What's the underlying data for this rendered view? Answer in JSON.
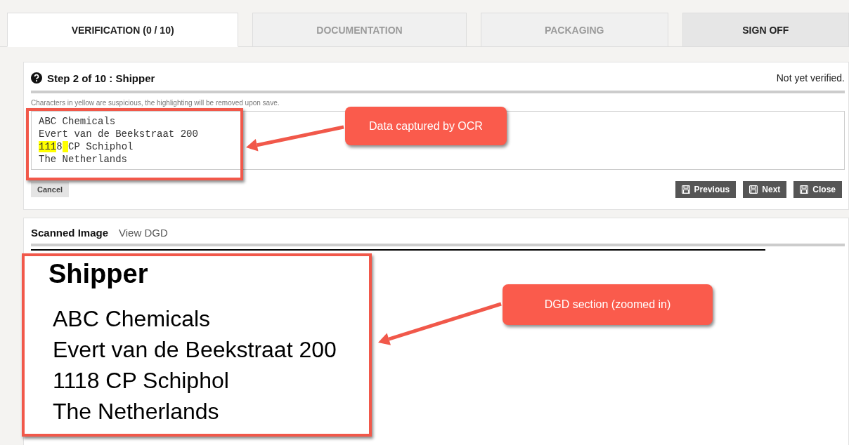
{
  "tabs": [
    {
      "label": "VERIFICATION (0 / 10)",
      "selected": true,
      "disabled": false
    },
    {
      "label": "DOCUMENTATION",
      "selected": false,
      "disabled": true
    },
    {
      "label": "PACKAGING",
      "selected": false,
      "disabled": true
    },
    {
      "label": "SIGN OFF",
      "selected": false,
      "disabled": false
    }
  ],
  "step": {
    "title": "Step 2 of 10 : Shipper",
    "status": "Not yet verified.",
    "hint": "Characters in yellow are suspicious, the highlighting will be removed upon save.",
    "ocr_lines": [
      [
        {
          "text": "ABC Chemicals",
          "suspicious": false
        }
      ],
      [
        {
          "text": "Evert van de Beekstraat 200",
          "suspicious": false
        }
      ],
      [
        {
          "text": "111",
          "suspicious": true
        },
        {
          "text": "8",
          "suspicious": false
        },
        {
          "text": "CP Schiphol",
          "suspicious": false,
          "space_before_suspicious": true
        }
      ],
      [
        {
          "text": "The Netherlands",
          "suspicious": false
        }
      ]
    ],
    "cancel": "Cancel",
    "buttons": [
      "Previous",
      "Next",
      "Close"
    ]
  },
  "viewer": {
    "tabs": [
      {
        "label": "Scanned Image",
        "selected": true
      },
      {
        "label": "View DGD",
        "selected": false
      }
    ],
    "document": {
      "heading": "Shipper",
      "lines": [
        "ABC Chemicals",
        "Evert van de Beekstraat 200",
        "1118 CP Schiphol",
        "The Netherlands"
      ]
    }
  },
  "annotations": [
    "Data captured by OCR",
    "DGD section (zoomed in)"
  ]
}
